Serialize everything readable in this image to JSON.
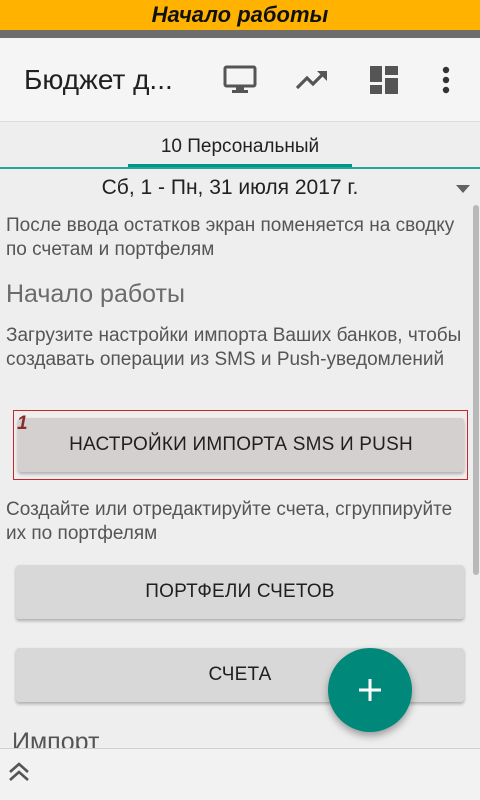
{
  "banner": {
    "text": "Начало работы"
  },
  "appbar": {
    "title": "Бюджет д...",
    "icons": [
      "monitor-icon",
      "trending-up-icon",
      "dashboard-icon",
      "more-vert-icon"
    ]
  },
  "tabs": {
    "active": "10 Персональный"
  },
  "date": {
    "range": "Сб, 1 - Пн, 31 июля 2017 г."
  },
  "content": {
    "intro": "После ввода остатков экран поменяется на сводку по счетам и портфелям",
    "heading": "Начало работы",
    "import_hint": "Загрузите настройки импорта Ваших банков, чтобы создавать операции из SMS и Push-уведомлений",
    "highlight_number": "1",
    "sms_button": "НАСТРОЙКИ ИМПОРТА SMS И PUSH",
    "accounts_hint": "Создайте или отредактируйте счета, сгруппируйте их по портфелям",
    "portfolios_button": "ПОРТФЕЛИ СЧЕТОВ",
    "accounts_button": "СЧЕТА",
    "next_heading": "Импорт"
  },
  "colors": {
    "banner": "#ffb300",
    "accent": "#009688",
    "fab": "#00897b",
    "highlight_border": "#c62828"
  }
}
